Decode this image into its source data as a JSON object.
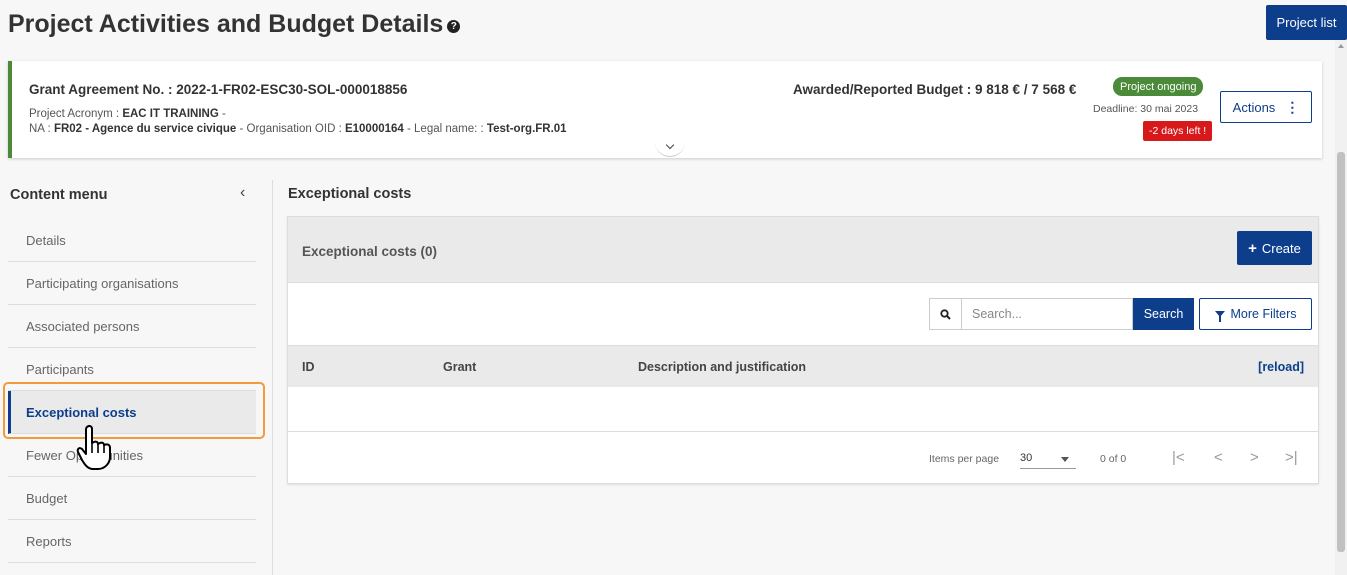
{
  "header": {
    "title": "Project Activities and Budget Details",
    "help_glyph": "?",
    "project_list_label": "Project list"
  },
  "grant": {
    "agreement_label": "Grant Agreement No. : ",
    "agreement_no": "2022-1-FR02-ESC30-SOL-000018856",
    "acronym_label": "Project Acronym : ",
    "acronym": "EAC IT TRAINING",
    "acronym_suffix": " -",
    "na_label": "NA : ",
    "na": "FR02 - Agence du service civique",
    "oid_label": " - Organisation OID : ",
    "oid": "E10000164",
    "legal_label": " - Legal name: : ",
    "legal_name": "Test-org.FR.01",
    "budget_label": "Awarded/Reported Budget : ",
    "budget": "9 818 € / 7 568 €",
    "status": "Project ongoing",
    "deadline": "Deadline: 30 mai 2023",
    "days_left": "-2 days left !",
    "actions_label": "Actions",
    "actions_glyph": "⋮"
  },
  "sidebar": {
    "title": "Content menu",
    "collapse_glyph": "‹",
    "items": [
      {
        "label": "Details"
      },
      {
        "label": "Participating organisations"
      },
      {
        "label": "Associated persons"
      },
      {
        "label": "Participants"
      },
      {
        "label": "Exceptional costs"
      },
      {
        "label": "Fewer Opportunities"
      },
      {
        "label": "Budget"
      },
      {
        "label": "Reports"
      }
    ],
    "active_index": 4
  },
  "main": {
    "section_title": "Exceptional costs",
    "panel_title": "Exceptional costs (0)",
    "create_label": "Create",
    "create_glyph": "+",
    "search_placeholder": "Search...",
    "search_button": "Search",
    "more_filters": "More Filters",
    "columns": [
      "ID",
      "Grant",
      "Description and justification"
    ],
    "reload": "[reload]",
    "pager": {
      "items_per_page_label": "Items per page",
      "items_per_page": "30",
      "range": "0 of 0",
      "first": "|<",
      "prev": "<",
      "next": ">",
      "last": ">|"
    }
  },
  "colors": {
    "primary": "#0d3e8c",
    "success": "#4a8a39",
    "danger": "#d7191c",
    "highlight": "#f39a3a"
  }
}
